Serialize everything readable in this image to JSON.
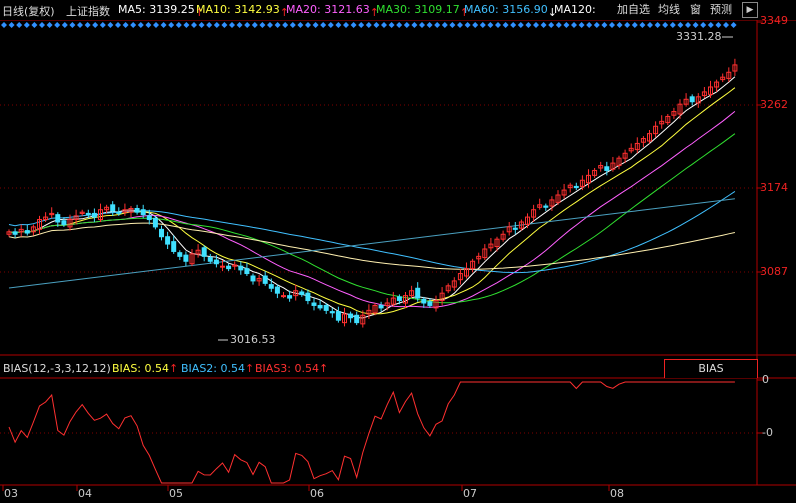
{
  "header": {
    "title": "日线(复权)",
    "symbol": "上证指数",
    "ma_items": [
      {
        "label": "MA5: 3139.25",
        "arrow": "↑",
        "color": "#ffffff"
      },
      {
        "label": "MA10: 3142.93",
        "arrow": "↑",
        "color": "#ffff40"
      },
      {
        "label": "MA20: 3121.63",
        "arrow": "↑",
        "color": "#ff60ff"
      },
      {
        "label": "MA30: 3109.17",
        "arrow": "↑",
        "color": "#30e030"
      },
      {
        "label": "MA60: 3156.90",
        "arrow": "↓",
        "color": "#40c0ff"
      },
      {
        "label": "MA120:",
        "arrow": "",
        "color": "#ffffff"
      }
    ],
    "buttons": [
      "加自选",
      "均线",
      "窗",
      "预测"
    ],
    "scroll_icon": "scroll-right-icon"
  },
  "price_axis": [
    "3349",
    "3262",
    "3174",
    "3087"
  ],
  "bias_axis": [
    "0",
    "-0"
  ],
  "date_labels": [
    "03",
    "04",
    "05",
    "06",
    "07",
    "08"
  ],
  "annotations": {
    "high": "3331.28",
    "low": "3016.53"
  },
  "bias_panel": {
    "name": "BIAS(12,-3,3,12,12)",
    "bias": "BIAS: 0.54",
    "bias2": "BIAS2: 0.54",
    "bias3": "BIAS3: 0.54",
    "arrow": "↑",
    "tab": "BIAS"
  },
  "colors": {
    "up": "#ff3030",
    "down": "#40e0ff",
    "grid": "#800000",
    "ma5": "#ffffff",
    "ma10": "#ffff40",
    "ma20": "#ff60ff",
    "ma30": "#30e030",
    "ma60": "#40c0ff",
    "ma120": "#fff0b0",
    "ma250": "#4aa0c0"
  }
}
